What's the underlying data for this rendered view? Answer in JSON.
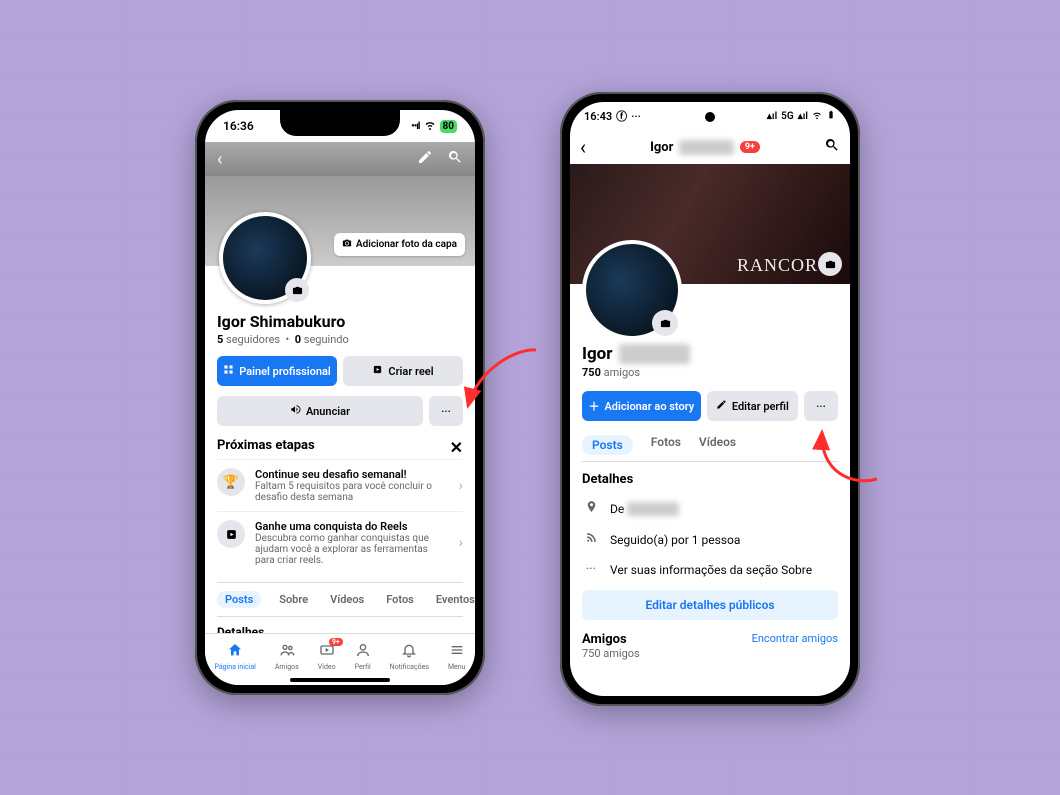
{
  "phone1": {
    "status": {
      "time": "16:36",
      "battery": "80"
    },
    "cover": {
      "add_cover_label": "Adicionar foto da capa"
    },
    "profile": {
      "name": "Igor Shimabukuro",
      "followers_count": "5",
      "followers_label": "seguidores",
      "following_count": "0",
      "following_label": "seguindo"
    },
    "buttons": {
      "dashboard": "Painel profissional",
      "reel": "Criar reel",
      "advertise": "Anunciar",
      "more": "···"
    },
    "next_steps": {
      "title": "Próximas etapas",
      "items": [
        {
          "icon": "trophy",
          "title": "Continue seu desafio semanal!",
          "sub": "Faltam 5 requisitos para você concluir o desafio desta semana"
        },
        {
          "icon": "reels",
          "title": "Ganhe uma conquista do Reels",
          "sub": "Descubra como ganhar conquistas que ajudam você a explorar as ferramentas para criar reels."
        }
      ]
    },
    "tabs": [
      "Posts",
      "Sobre",
      "Vídeos",
      "Fotos",
      "Eventos"
    ],
    "details_label": "Detalhes",
    "nav": {
      "items": [
        {
          "id": "home",
          "label": "Página inicial",
          "active": true
        },
        {
          "id": "friends",
          "label": "Amigos"
        },
        {
          "id": "video",
          "label": "Vídeo",
          "badge": "9+"
        },
        {
          "id": "profile",
          "label": "Perfil"
        },
        {
          "id": "notifications",
          "label": "Notificações"
        },
        {
          "id": "menu",
          "label": "Menu"
        }
      ]
    }
  },
  "phone2": {
    "status": {
      "time": "16:43",
      "network": "5G"
    },
    "header": {
      "name_visible": "Igor",
      "badge": "9+"
    },
    "cover": {
      "text": "RANCOR"
    },
    "profile": {
      "name_visible": "Igor",
      "friends_count": "750",
      "friends_label": "amigos"
    },
    "buttons": {
      "add_story": "Adicionar ao story",
      "edit_profile": "Editar perfil",
      "more": "···"
    },
    "tabs": [
      "Posts",
      "Fotos",
      "Vídeos"
    ],
    "details": {
      "title": "Detalhes",
      "rows": [
        {
          "icon": "pin",
          "text_prefix": "De",
          "redacted": true
        },
        {
          "icon": "rss",
          "text": "Seguido(a) por 1 pessoa"
        },
        {
          "icon": "dots",
          "text": "Ver suas informações da seção Sobre"
        }
      ],
      "edit_public": "Editar detalhes públicos"
    },
    "friends_section": {
      "title": "Amigos",
      "find": "Encontrar amigos",
      "sub": "750 amigos"
    }
  }
}
